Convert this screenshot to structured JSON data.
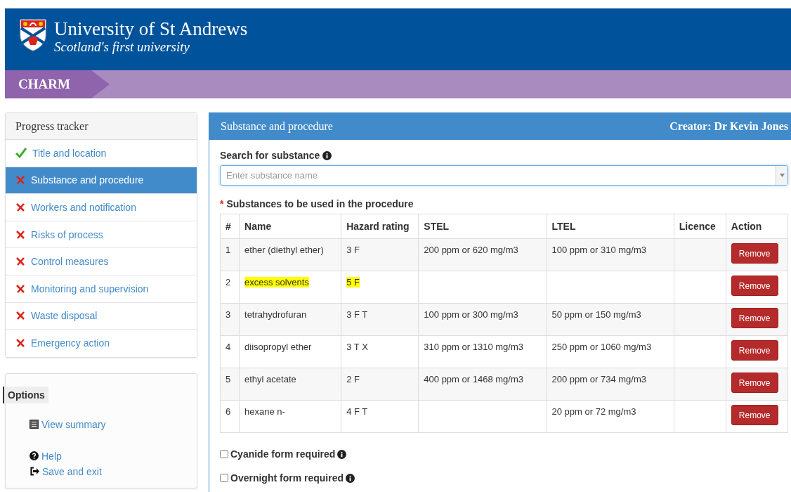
{
  "header": {
    "title": "University of St Andrews",
    "tagline": "Scotland's first university"
  },
  "app_bar": {
    "title": "CHARM"
  },
  "progress_tracker": {
    "title": "Progress tracker",
    "items": [
      {
        "label": "Title and location",
        "done": true,
        "selected": false
      },
      {
        "label": "Substance and procedure",
        "done": false,
        "selected": true
      },
      {
        "label": "Workers and notification",
        "done": false,
        "selected": false
      },
      {
        "label": "Risks of process",
        "done": false,
        "selected": false
      },
      {
        "label": "Control measures",
        "done": false,
        "selected": false
      },
      {
        "label": "Monitoring and supervision",
        "done": false,
        "selected": false
      },
      {
        "label": "Waste disposal",
        "done": false,
        "selected": false
      },
      {
        "label": "Emergency action",
        "done": false,
        "selected": false
      }
    ]
  },
  "options": {
    "title": "Options",
    "links": [
      "View summary",
      "Help",
      "Save and exit"
    ]
  },
  "panel": {
    "title": "Substance and procedure",
    "creator": "Creator: Dr Kevin Jones",
    "search": {
      "label": "Search for substance",
      "placeholder": "Enter substance name"
    },
    "required_mark": "*",
    "table_title": "Substances to be used in the procedure",
    "columns": [
      "#",
      "Name",
      "Hazard rating",
      "STEL",
      "LTEL",
      "Licence",
      "Action"
    ],
    "rows": [
      {
        "cells": [
          "1",
          "ether (diethyl ether)",
          "3 F",
          "200 ppm or 620 mg/m3",
          "100 ppm or 310 mg/m3",
          ""
        ],
        "highlighted": false,
        "action": "Remove"
      },
      {
        "cells": [
          "2",
          "excess solvents",
          "5 F",
          "",
          "",
          ""
        ],
        "highlighted": true,
        "action": "Remove"
      },
      {
        "cells": [
          "3",
          "tetrahydrofuran",
          "3 F T",
          "100 ppm or 300 mg/m3",
          "50 ppm or 150 mg/m3",
          ""
        ],
        "highlighted": false,
        "action": "Remove"
      },
      {
        "cells": [
          "4",
          "diisopropyl ether",
          "3 T X",
          "310 ppm or 1310 mg/m3",
          "250 ppm or 1060 mg/m3",
          ""
        ],
        "highlighted": false,
        "action": "Remove"
      },
      {
        "cells": [
          "5",
          "ethyl acetate",
          "2 F",
          "400 ppm or 1468 mg/m3",
          "200 ppm or 734 mg/m3",
          ""
        ],
        "highlighted": false,
        "action": "Remove"
      },
      {
        "cells": [
          "6",
          "hexane n-",
          "4 F T",
          "",
          "20 ppm or 72 mg/m3",
          ""
        ],
        "highlighted": false,
        "action": "Remove"
      }
    ],
    "checkboxes": [
      {
        "label": "Cyanide form required",
        "checked": false
      },
      {
        "label": "Overnight form required",
        "checked": false
      }
    ]
  }
}
